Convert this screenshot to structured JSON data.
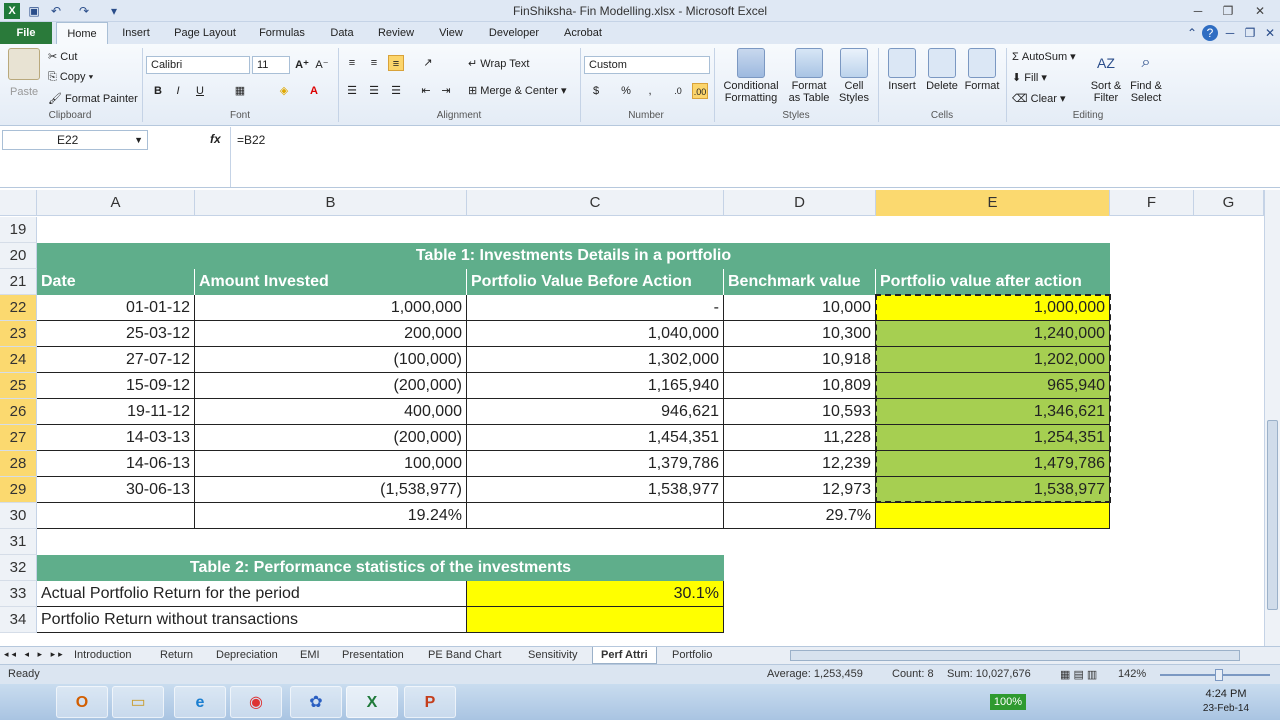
{
  "window": {
    "title": "FinShiksha- Fin Modelling.xlsx  -  Microsoft Excel"
  },
  "ribbon_tabs": [
    "File",
    "Home",
    "Insert",
    "Page Layout",
    "Formulas",
    "Data",
    "Review",
    "View",
    "Developer",
    "Acrobat"
  ],
  "clipboard": {
    "paste": "Paste",
    "cut": "Cut",
    "copy": "Copy",
    "format_painter": "Format Painter",
    "label": "Clipboard"
  },
  "font": {
    "name": "Calibri",
    "size": "11",
    "label": "Font"
  },
  "alignment": {
    "wrap": "Wrap Text",
    "merge": "Merge & Center",
    "label": "Alignment"
  },
  "number": {
    "format": "Custom",
    "label": "Number"
  },
  "styles": {
    "cond": "Conditional",
    "cond2": "Formatting",
    "fmt": "Format",
    "fmt2": "as Table",
    "cell": "Cell",
    "cell2": "Styles",
    "label": "Styles"
  },
  "cells": {
    "insert": "Insert",
    "delete": "Delete",
    "format": "Format",
    "label": "Cells"
  },
  "editing": {
    "autosum": "AutoSum",
    "fill": "Fill",
    "clear": "Clear",
    "sort": "Sort &",
    "sort2": "Filter",
    "find": "Find &",
    "find2": "Select",
    "label": "Editing"
  },
  "formula_bar": {
    "name_box": "E22",
    "fx": "fx",
    "formula": "=B22"
  },
  "columns": [
    "A",
    "B",
    "C",
    "D",
    "E",
    "F",
    "G"
  ],
  "rows": [
    "19",
    "20",
    "21",
    "22",
    "23",
    "24",
    "25",
    "26",
    "27",
    "28",
    "29",
    "30",
    "31",
    "32",
    "33",
    "34"
  ],
  "table1": {
    "title": "Table 1: Investments Details in a portfolio",
    "headers": [
      "Date",
      "Amount Invested",
      "Portfolio Value Before Action",
      "Benchmark value",
      "Portfolio value after action"
    ],
    "rows": [
      [
        "01-01-12",
        "1,000,000",
        "-",
        "10,000",
        "1,000,000"
      ],
      [
        "25-03-12",
        "200,000",
        "1,040,000",
        "10,300",
        "1,240,000"
      ],
      [
        "27-07-12",
        "(100,000)",
        "1,302,000",
        "10,918",
        "1,202,000"
      ],
      [
        "15-09-12",
        "(200,000)",
        "1,165,940",
        "10,809",
        "965,940"
      ],
      [
        "19-11-12",
        "400,000",
        "946,621",
        "10,593",
        "1,346,621"
      ],
      [
        "14-03-13",
        "(200,000)",
        "1,454,351",
        "11,228",
        "1,254,351"
      ],
      [
        "14-06-13",
        "100,000",
        "1,379,786",
        "12,239",
        "1,479,786"
      ],
      [
        "30-06-13",
        "(1,538,977)",
        "1,538,977",
        "12,973",
        "1,538,977"
      ]
    ],
    "totals": {
      "b": "19.24%",
      "d": "29.7%"
    }
  },
  "table2": {
    "title": "Table 2: Performance statistics of the investments",
    "r1_label": "Actual Portfolio Return for the period",
    "r1_value": "30.1%",
    "r2_label": "Portfolio Return without transactions"
  },
  "sheet_tabs": [
    "Introduction",
    "Return",
    "Depreciation",
    "EMI",
    "Presentation",
    "PE Band Chart",
    "Sensitivity",
    "Perf Attri",
    "Portfolio"
  ],
  "active_sheet": "Perf Attri",
  "status": {
    "ready": "Ready",
    "average": "Average: 1,253,459",
    "count": "Count: 8",
    "sum": "Sum: 10,027,676",
    "zoom": "142%"
  },
  "taskbar": {
    "battery": "100%",
    "time": "4:24 PM",
    "date": "23-Feb-14"
  }
}
